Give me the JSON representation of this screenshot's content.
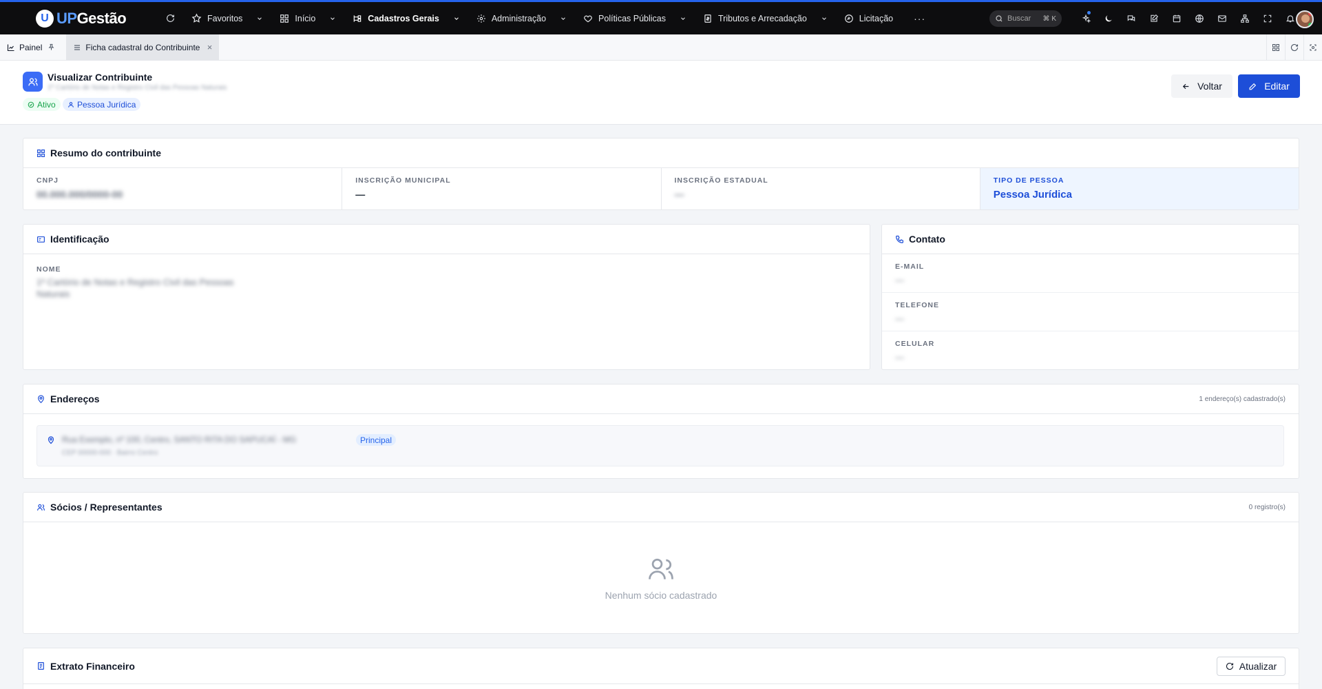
{
  "app": {
    "logo_letter": "U",
    "logo_up": "UP",
    "logo_rest": "Gestão"
  },
  "nav": {
    "items": [
      {
        "label": "Favoritos",
        "icon": "star-icon"
      },
      {
        "label": "Início",
        "icon": "grid-icon"
      },
      {
        "label": "Cadastros Gerais",
        "icon": "hierarchy-icon"
      },
      {
        "label": "Administração",
        "icon": "gear-icon"
      },
      {
        "label": "Políticas Públicas",
        "icon": "heart-icon"
      },
      {
        "label": "Tributos e Arrecadação",
        "icon": "receipt-icon"
      },
      {
        "label": "Licitação",
        "icon": "gavel-icon"
      }
    ],
    "more": "···",
    "search_placeholder": "Buscar",
    "search_shortcut": "⌘ K"
  },
  "tabs": {
    "painel": "Painel",
    "active": "Ficha cadastral do Contribuinte",
    "close": "×"
  },
  "header": {
    "title": "Visualizar Contribuinte",
    "subtitle": "1º Cartório de Notas e Registro Civil das Pessoas Naturais",
    "status_badge": "Ativo",
    "type_badge": "Pessoa Jurídica",
    "back_label": "Voltar",
    "edit_label": "Editar"
  },
  "summary": {
    "title": "Resumo do contribuinte",
    "fields": [
      {
        "label": "CNPJ",
        "value": "00.000.000/0000-00"
      },
      {
        "label": "INSCRIÇÃO MUNICIPAL",
        "value": "—"
      },
      {
        "label": "INSCRIÇÃO ESTADUAL",
        "value": "—"
      },
      {
        "label": "TIPO DE PESSOA",
        "value": "Pessoa Jurídica"
      }
    ]
  },
  "identificacao": {
    "title": "Identificação",
    "name_label": "NOME",
    "name_line1": "1º Cartório de Notas e Registro Civil das Pessoas",
    "name_line2": "Naturais"
  },
  "contato": {
    "title": "Contato",
    "fields": [
      {
        "label": "E-MAIL",
        "value": "—"
      },
      {
        "label": "TELEFONE",
        "value": "—"
      },
      {
        "label": "CELULAR",
        "value": "—"
      }
    ]
  },
  "enderecos": {
    "title": "Endereços",
    "count": "1 endereço(s) cadastrado(s)",
    "address": "Rua Exemplo, nº 100, Centro, SANTO RITA DO SAPUCAÍ - MG",
    "address_sub": "CEP 00000-000 · Bairro Centro",
    "principal": "Principal"
  },
  "socios": {
    "title": "Sócios / Representantes",
    "count": "0 registro(s)",
    "empty": "Nenhum sócio cadastrado"
  },
  "extrato": {
    "title": "Extrato Financeiro",
    "refresh_label": "Atualizar"
  },
  "colors": {
    "accent": "#1d4ed8",
    "topbar": "#0d0d0f",
    "success": "#16a34a"
  }
}
